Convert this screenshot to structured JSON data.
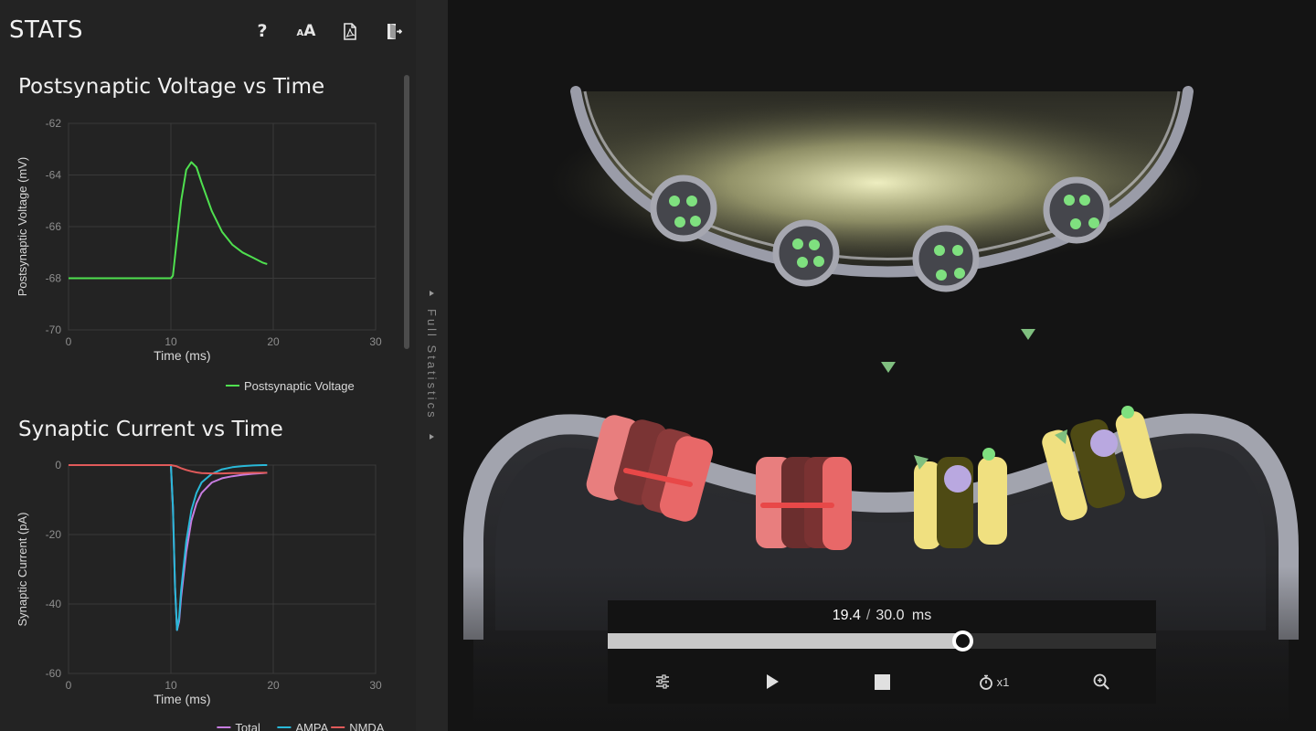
{
  "header": {
    "title": "STATS",
    "help_icon": "question-mark-icon",
    "font_size_icon": "font-size-icon",
    "pdf_icon": "pdf-export-icon",
    "exit_icon": "exit-door-icon"
  },
  "divider": {
    "label": "Full Statistics"
  },
  "charts": {
    "voltage_title": "Postsynaptic Voltage vs Time",
    "current_title": "Synaptic Current vs Time"
  },
  "chart_data": [
    {
      "type": "line",
      "title": "Postsynaptic Voltage vs Time",
      "xlabel": "Time (ms)",
      "ylabel": "Postsynaptic Voltage (mV)",
      "xlim": [
        0,
        30
      ],
      "ylim": [
        -70,
        -62
      ],
      "xticks": [
        0,
        10,
        20,
        30
      ],
      "yticks": [
        -62,
        -64,
        -66,
        -68,
        -70
      ],
      "grid": true,
      "legend": "bottom-right",
      "series": [
        {
          "name": "Postsynaptic Voltage",
          "color": "#4fe04f",
          "x": [
            0,
            10,
            10.2,
            10.5,
            11,
            11.5,
            12,
            12.5,
            13,
            14,
            15,
            16,
            17,
            18,
            19,
            19.4
          ],
          "y": [
            -68,
            -68,
            -67.9,
            -66.8,
            -65,
            -63.8,
            -63.5,
            -63.7,
            -64.3,
            -65.4,
            -66.2,
            -66.7,
            -67.0,
            -67.2,
            -67.4,
            -67.45
          ]
        }
      ]
    },
    {
      "type": "line",
      "title": "Synaptic Current vs Time",
      "xlabel": "Time (ms)",
      "ylabel": "Synaptic Current (pA)",
      "xlim": [
        0,
        30
      ],
      "ylim": [
        -60,
        0
      ],
      "xticks": [
        0,
        10,
        20,
        30
      ],
      "yticks": [
        0,
        -20,
        -40,
        -60
      ],
      "grid": true,
      "legend": "bottom-right",
      "series": [
        {
          "name": "Total",
          "color": "#c77de0",
          "x": [
            0,
            10,
            10.2,
            10.4,
            10.6,
            10.8,
            11,
            11.5,
            12,
            12.5,
            13,
            14,
            15,
            16,
            17,
            18,
            19,
            19.4
          ],
          "y": [
            0,
            0,
            -12,
            -35,
            -47.5,
            -45,
            -38,
            -25,
            -16,
            -11,
            -8,
            -5,
            -3.8,
            -3.2,
            -2.8,
            -2.5,
            -2.3,
            -2.2
          ]
        },
        {
          "name": "AMPA",
          "color": "#29b8d8",
          "x": [
            0,
            10,
            10.2,
            10.4,
            10.6,
            10.8,
            11,
            11.5,
            12,
            12.5,
            13,
            14,
            15,
            16,
            17,
            18,
            19,
            19.4
          ],
          "y": [
            0,
            0,
            -12,
            -35,
            -47.5,
            -44,
            -36,
            -22,
            -13,
            -8,
            -5,
            -2.5,
            -1.2,
            -0.6,
            -0.3,
            -0.1,
            0,
            0
          ]
        },
        {
          "name": "NMDA",
          "color": "#e05a5a",
          "x": [
            0,
            10,
            10.5,
            11,
            11.5,
            12,
            12.5,
            13,
            14,
            15,
            16,
            17,
            18,
            19,
            19.4
          ],
          "y": [
            0,
            0,
            -0.3,
            -0.9,
            -1.4,
            -1.8,
            -2.1,
            -2.3,
            -2.4,
            -2.4,
            -2.3,
            -2.3,
            -2.2,
            -2.2,
            -2.2
          ]
        }
      ]
    }
  ],
  "playback": {
    "current": "19.4",
    "separator": "/",
    "total": "30.0",
    "unit": "ms",
    "progress": 0.647,
    "speed": "x1",
    "settings_icon": "sliders-icon",
    "play_icon": "play-icon",
    "stop_icon": "stop-icon",
    "speed_icon": "stopwatch-icon",
    "zoom_icon": "zoom-in-icon"
  }
}
